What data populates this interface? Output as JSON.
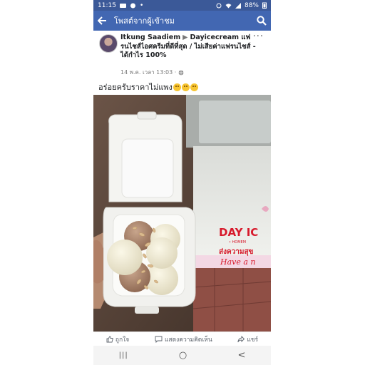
{
  "status_bar": {
    "time": "11:15",
    "battery": "88%"
  },
  "app_bar": {
    "title": "โพสต์จากผู้เข้าชม",
    "back_icon": "arrow-left-icon",
    "search_icon": "search-icon"
  },
  "post": {
    "author": "Itkung Saadiem",
    "page": "Dayicecream แฟรนไชส์ไอศครีมที่ดีที่สุด / ไม่เสียค่าแฟรนไชส์ - ได้กำไร 100%",
    "timestamp": "14 พ.ค. เวลา 13:03 ·",
    "text": "อร่อยครับราคาไม่แพง"
  },
  "photo": {
    "sign_text": "DAY IC",
    "sign_sub": "• HOMEM",
    "sign_thai": "ส่งความสุข",
    "sign_script": "Have a n"
  },
  "actions": {
    "like": "ถูกใจ",
    "comment": "แสดงความคิดเห็น",
    "share": "แชร์"
  },
  "nav": {
    "recent": "|||",
    "home": "○",
    "back": "<"
  },
  "colors": {
    "status_bar": "#3b5998",
    "app_bar": "#4267b2",
    "sign_red": "#d7192b"
  }
}
